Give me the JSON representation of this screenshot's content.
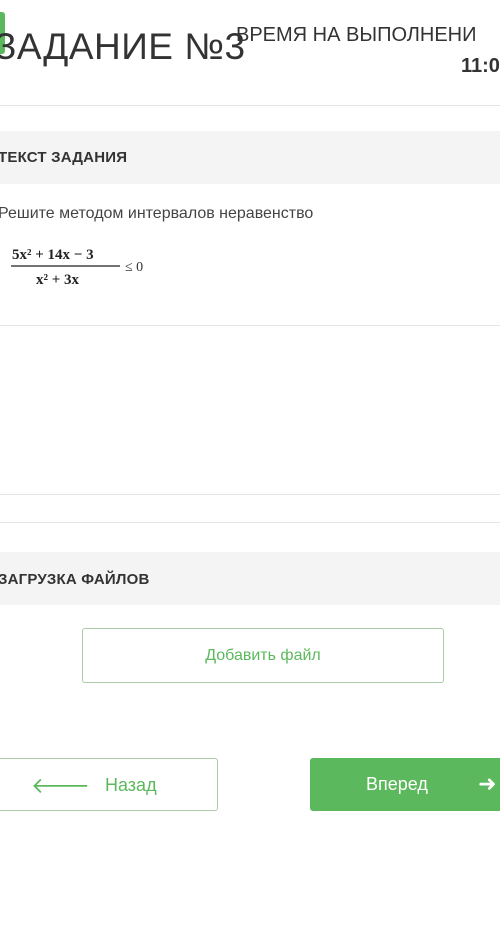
{
  "header": {
    "task_title": "ЗАДАНИЕ №3",
    "timer_label": "ВРЕМЯ НА ВЫПОЛНЕНИ",
    "timer_value": "11:0"
  },
  "task_section": {
    "title": "ТЕКСТ ЗАДАНИЯ",
    "text": "Решите методом интервалов неравенство",
    "formula": {
      "numerator": "5x² + 14x − 3",
      "denominator": "x² + 3x",
      "relation": "≤ 0"
    }
  },
  "upload_section": {
    "title": "ЗАГРУЗКА ФАЙЛОВ",
    "add_file_label": "Добавить файл"
  },
  "navigation": {
    "back_label": "Назад",
    "back_icon": "arrow-left-icon",
    "next_label": "Вперед",
    "next_icon": "arrow-right-icon"
  },
  "colors": {
    "accent": "#5cb85c",
    "section_bg": "#f4f4f4",
    "divider": "#e4e4e4"
  }
}
